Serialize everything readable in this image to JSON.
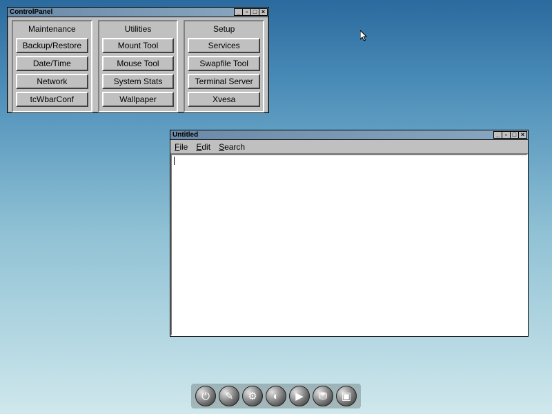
{
  "controlPanel": {
    "title": "ControlPanel",
    "columns": [
      {
        "title": "Maintenance",
        "items": [
          "Backup/Restore",
          "Date/Time",
          "Network",
          "tcWbarConf"
        ]
      },
      {
        "title": "Utilities",
        "items": [
          "Mount Tool",
          "Mouse Tool",
          "System Stats",
          "Wallpaper"
        ]
      },
      {
        "title": "Setup",
        "items": [
          "Services",
          "Swapfile Tool",
          "Terminal Server",
          "Xvesa"
        ]
      }
    ]
  },
  "editor": {
    "title": "Untitled",
    "menus": [
      {
        "label": "File",
        "accel": "F"
      },
      {
        "label": "Edit",
        "accel": "E"
      },
      {
        "label": "Search",
        "accel": "S"
      }
    ],
    "content": ""
  },
  "windowButtons": {
    "min": "_",
    "max": "□",
    "restore": "▫",
    "close": "×"
  },
  "dock": {
    "items": [
      {
        "name": "exit",
        "glyph": "⏻"
      },
      {
        "name": "editor",
        "glyph": "✎"
      },
      {
        "name": "control-panel",
        "glyph": "⚙"
      },
      {
        "name": "apps",
        "glyph": "◐"
      },
      {
        "name": "run",
        "glyph": "▶"
      },
      {
        "name": "mount",
        "glyph": "⛃"
      },
      {
        "name": "terminal",
        "glyph": "▣"
      }
    ]
  }
}
